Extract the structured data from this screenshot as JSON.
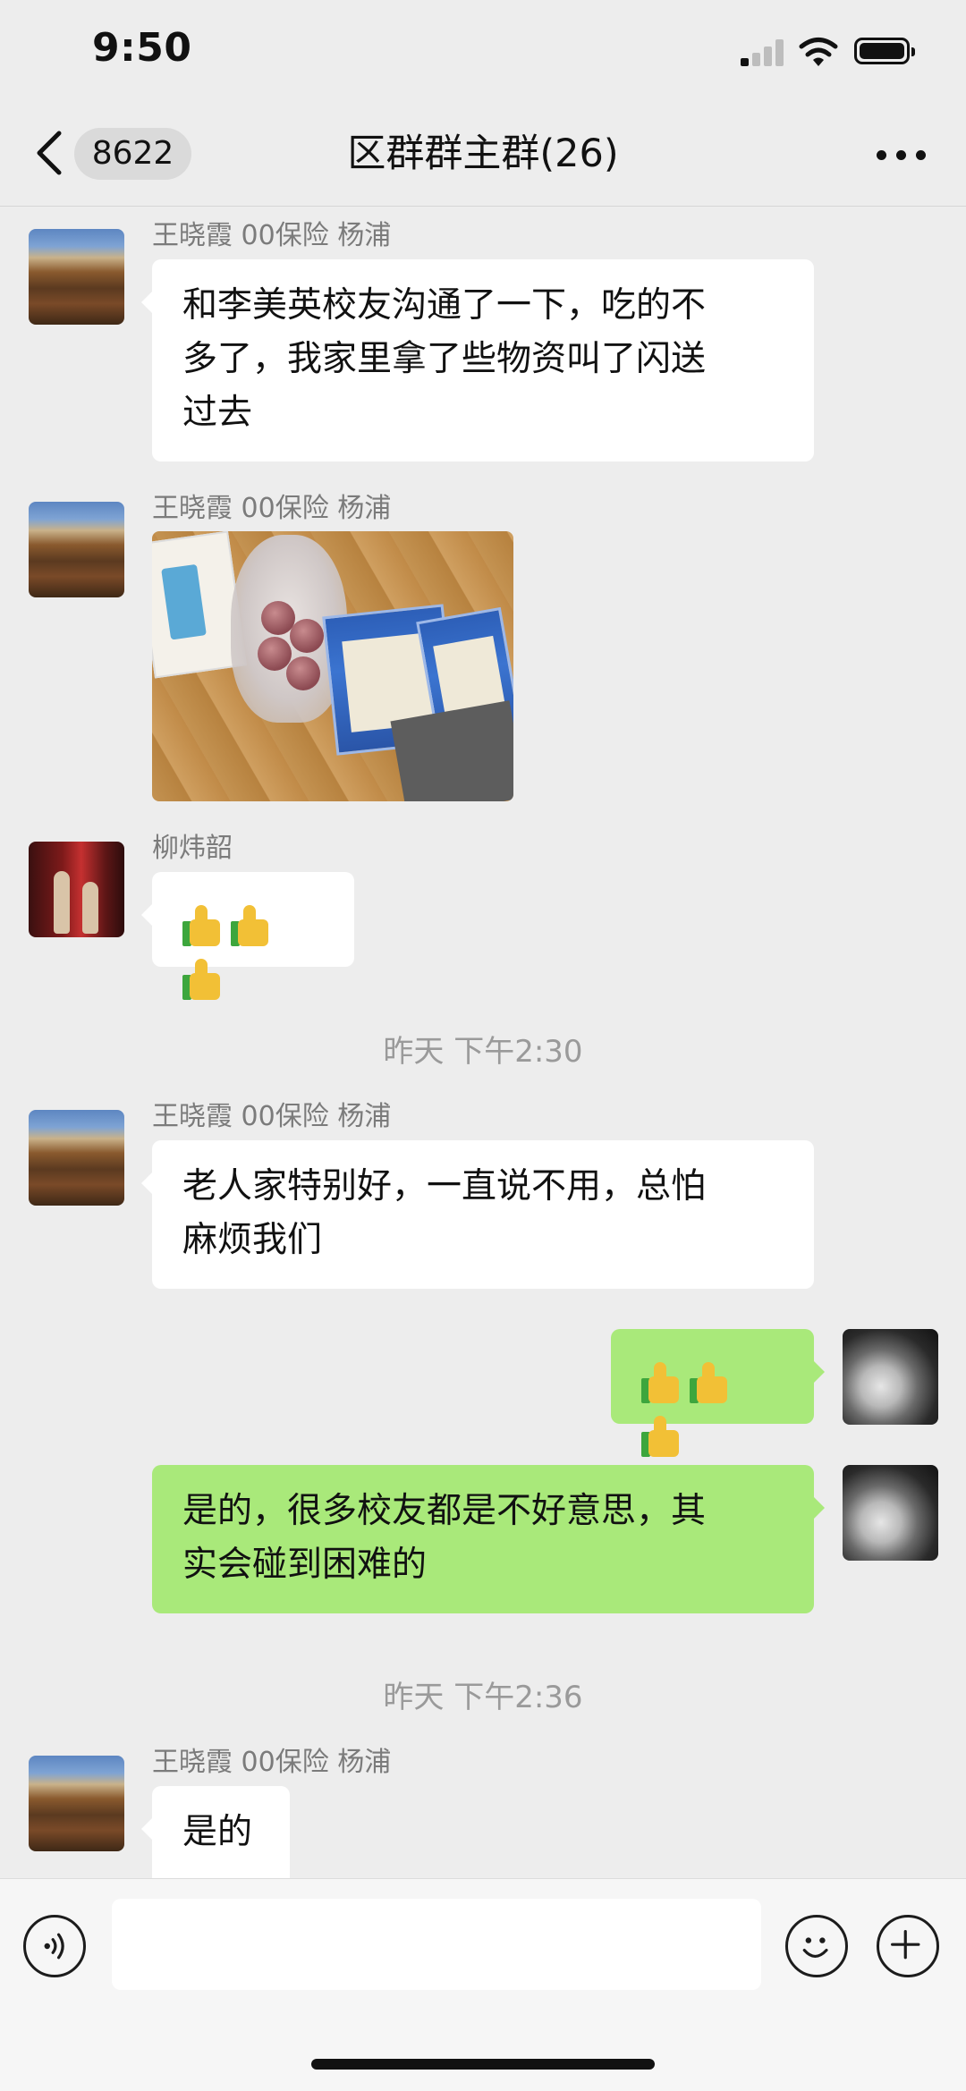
{
  "status_bar": {
    "time": "9:50"
  },
  "nav": {
    "back_badge": "8622",
    "title": "区群群主群(26)"
  },
  "messages": [
    {
      "sender": "王晓霞 00保险 杨浦",
      "text_lines": [
        "和李美英校友沟通了一下，吃的不",
        "多了，我家里拿了些物资叫了闪送",
        "过去"
      ]
    },
    {
      "sender": "王晓霞 00保险 杨浦",
      "image": "photo-supplies"
    },
    {
      "sender": "柳炜韶",
      "emoji": "thumbs-up x3"
    },
    {
      "timestamp": "昨天 下午2:30"
    },
    {
      "sender": "王晓霞 00保险 杨浦",
      "text_lines": [
        "老人家特别好，一直说不用，总怕",
        "麻烦我们"
      ]
    },
    {
      "self": true,
      "emoji": "thumbs-up x3"
    },
    {
      "self": true,
      "text_lines": [
        "是的，很多校友都是不好意思，其",
        "实会碰到困难的"
      ]
    },
    {
      "timestamp": "昨天 下午2:36"
    },
    {
      "sender": "王晓霞 00保险 杨浦",
      "text": "是的"
    }
  ],
  "colors": {
    "background": "#ededed",
    "self_bubble": "#a9e97a",
    "other_bubble": "#ffffff"
  }
}
